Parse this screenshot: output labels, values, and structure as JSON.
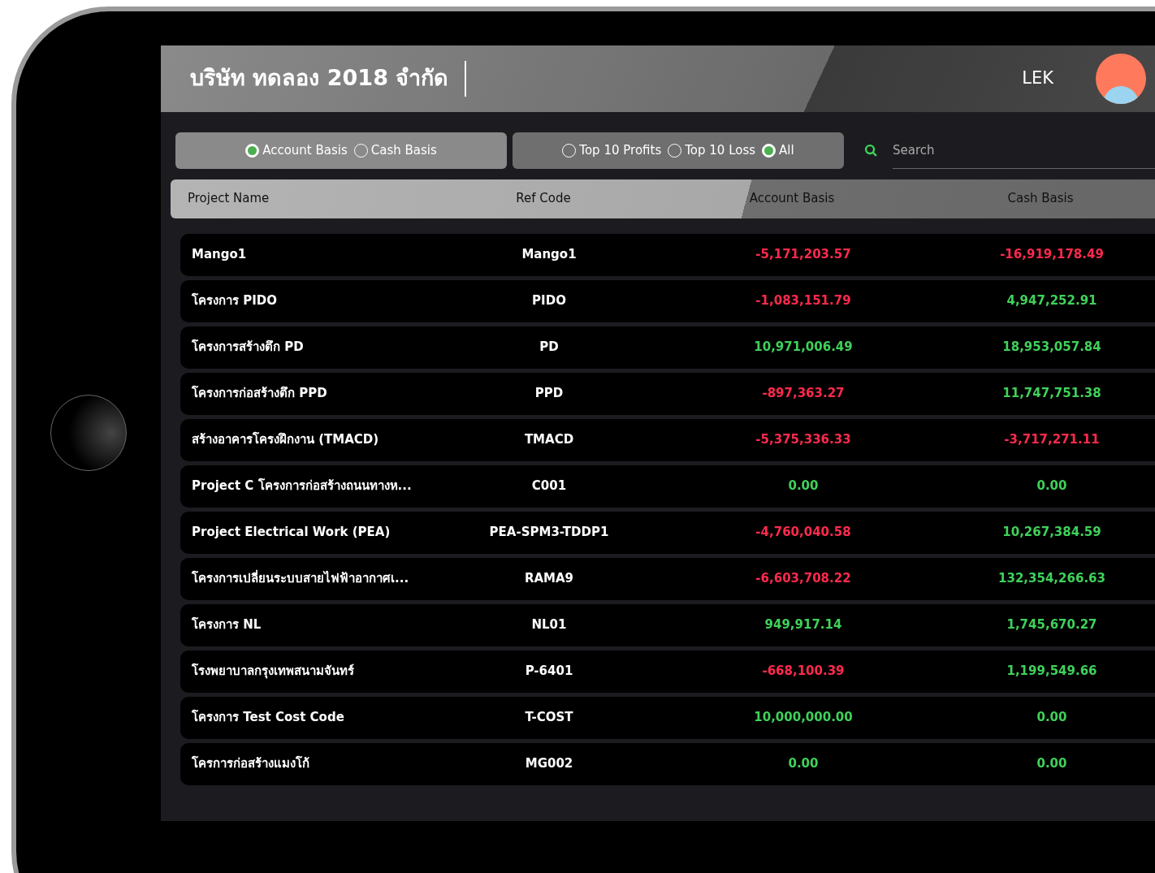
{
  "header": {
    "company": "บริษัท ทดลอง 2018 จำกัด",
    "user": "LEK"
  },
  "basis_filter": [
    {
      "label": "Account Basis",
      "selected": true
    },
    {
      "label": "Cash Basis",
      "selected": false
    }
  ],
  "rank_filter": [
    {
      "label": "Top 10 Profits",
      "selected": false
    },
    {
      "label": "Top 10 Loss",
      "selected": false
    },
    {
      "label": "All",
      "selected": true
    }
  ],
  "search": {
    "placeholder": "Search"
  },
  "table": {
    "columns": [
      "Project Name",
      "Ref Code",
      "Account Basis",
      "Cash Basis"
    ],
    "rows": [
      {
        "name": "Mango1",
        "ref": "Mango1",
        "account": {
          "text": "-5,171,203.57",
          "negative": true
        },
        "cash": {
          "text": "-16,919,178.49",
          "negative": true
        }
      },
      {
        "name": "โครงการ PIDO",
        "ref": "PIDO",
        "account": {
          "text": "-1,083,151.79",
          "negative": true
        },
        "cash": {
          "text": "4,947,252.91",
          "negative": false
        }
      },
      {
        "name": "โครงการสร้างตึก PD",
        "ref": "PD",
        "account": {
          "text": "10,971,006.49",
          "negative": false
        },
        "cash": {
          "text": "18,953,057.84",
          "negative": false
        }
      },
      {
        "name": "โครงการก่อสร้างตึก PPD",
        "ref": "PPD",
        "account": {
          "text": "-897,363.27",
          "negative": true
        },
        "cash": {
          "text": "11,747,751.38",
          "negative": false
        }
      },
      {
        "name": "สร้างอาคารโครงฝึกงาน (TMACD)",
        "ref": "TMACD",
        "account": {
          "text": "-5,375,336.33",
          "negative": true
        },
        "cash": {
          "text": "-3,717,271.11",
          "negative": true
        }
      },
      {
        "name": "Project C โครงการก่อสร้างถนนทางห...",
        "ref": "C001",
        "account": {
          "text": "0.00",
          "negative": false
        },
        "cash": {
          "text": "0.00",
          "negative": false
        }
      },
      {
        "name": "Project Electrical Work (PEA)",
        "ref": "PEA-SPM3-TDDP1",
        "account": {
          "text": "-4,760,040.58",
          "negative": true
        },
        "cash": {
          "text": "10,267,384.59",
          "negative": false
        }
      },
      {
        "name": "โครงการเปลี่ยนระบบสายไฟฟ้าอากาศเ...",
        "ref": "RAMA9",
        "account": {
          "text": "-6,603,708.22",
          "negative": true
        },
        "cash": {
          "text": "132,354,266.63",
          "negative": false
        }
      },
      {
        "name": "โครงการ NL",
        "ref": "NL01",
        "account": {
          "text": "949,917.14",
          "negative": false
        },
        "cash": {
          "text": "1,745,670.27",
          "negative": false
        }
      },
      {
        "name": "โรงพยาบาลกรุงเทพสนามจันทร์",
        "ref": "P-6401",
        "account": {
          "text": "-668,100.39",
          "negative": true
        },
        "cash": {
          "text": "1,199,549.66",
          "negative": false
        }
      },
      {
        "name": "โครงการ Test Cost Code",
        "ref": "T-COST",
        "account": {
          "text": "10,000,000.00",
          "negative": false
        },
        "cash": {
          "text": "0.00",
          "negative": false
        }
      },
      {
        "name": "โครการก่อสร้างแมงโก้",
        "ref": "MG002",
        "account": {
          "text": "0.00",
          "negative": false
        },
        "cash": {
          "text": "0.00",
          "negative": false
        }
      }
    ]
  }
}
